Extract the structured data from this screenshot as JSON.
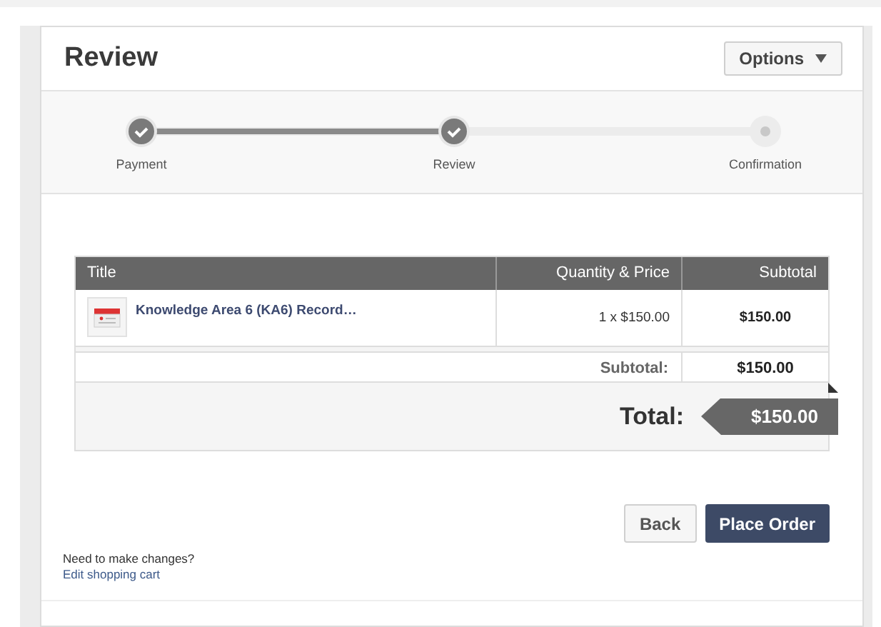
{
  "header": {
    "title": "Review",
    "options_button": "Options"
  },
  "steps": [
    {
      "label": "Payment",
      "completed": true
    },
    {
      "label": "Review",
      "completed": true
    },
    {
      "label": "Confirmation",
      "completed": false
    }
  ],
  "table": {
    "columns": [
      "Title",
      "Quantity & Price",
      "Subtotal"
    ],
    "rows": [
      {
        "title": "Knowledge Area 6 (KA6) Record…",
        "quantity_price": "1 x $150.00",
        "subtotal": "$150.00"
      }
    ],
    "subtotal_label": "Subtotal:",
    "subtotal_value": "$150.00",
    "total_label": "Total:",
    "total_value": "$150.00"
  },
  "buttons": {
    "back": "Back",
    "place_order": "Place Order"
  },
  "note": {
    "question": "Need to make changes?",
    "link": "Edit shopping cart"
  }
}
